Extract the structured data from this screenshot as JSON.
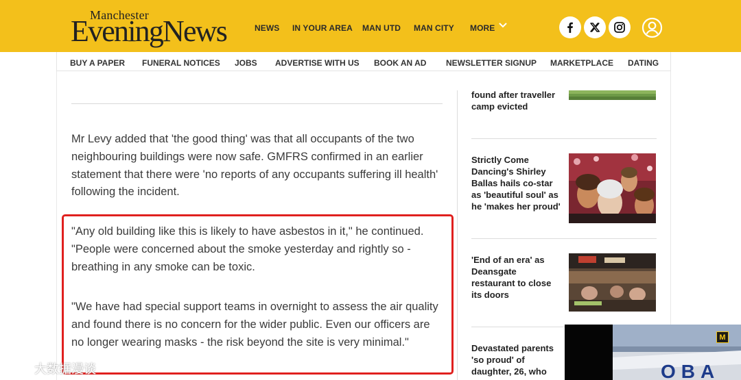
{
  "header": {
    "logo_top": "Manchester",
    "logo_main": "EveningNews",
    "nav": [
      "NEWS",
      "IN YOUR AREA",
      "MAN UTD",
      "MAN CITY",
      "MORE"
    ],
    "social_icons": [
      "facebook-icon",
      "x-icon",
      "instagram-icon"
    ],
    "brand_color": "#f3c01b"
  },
  "subnav": [
    "BUY A PAPER",
    "FUNERAL NOTICES",
    "JOBS",
    "ADVERTISE WITH US",
    "BOOK AN AD",
    "NEWSLETTER SIGNUP",
    "MARKETPLACE",
    "DATING"
  ],
  "article": {
    "paragraphs": [
      "Mr Levy added that 'the good thing' was that all occupants of the two neighbouring buildings were now safe. GMFRS confirmed in an earlier statement that there were 'no reports of any occupants suffering ill health' following the incident.",
      "\"Any old building like this is likely to have asbestos in it,\" he continued. \"People were concerned about the smoke yesterday and rightly so - breathing in any smoke can be toxic.",
      "\"We have had special support teams in overnight to assess the air quality and found there is no concern for the wider public. Even our officers are no longer wearing masks - the risk beyond the site is very minimal.\""
    ],
    "highlight_color": "#e0201e"
  },
  "sidebar": {
    "items": [
      {
        "title": "found after traveller camp evicted"
      },
      {
        "title": "Strictly Come Dancing's Shirley Ballas hails co-star as 'beautiful soul' as he 'makes her proud'"
      },
      {
        "title": "'End of an era' as Deansgate restaurant to close its doors"
      },
      {
        "title": "Devastated parents 'so proud' of daughter, 26, who"
      }
    ]
  },
  "video": {
    "badge": "M"
  },
  "watermark": {
    "text": "大数据漫谈"
  }
}
